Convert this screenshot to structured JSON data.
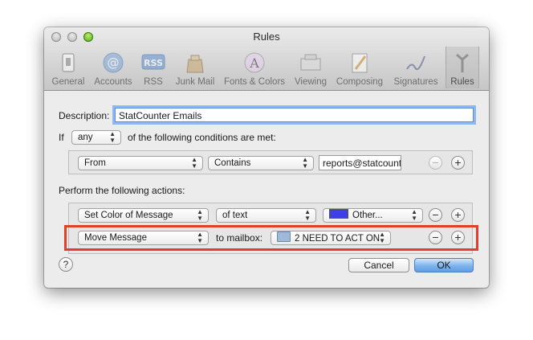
{
  "window": {
    "title": "Rules"
  },
  "toolbar": {
    "items": [
      {
        "label": "General"
      },
      {
        "label": "Accounts"
      },
      {
        "label": "RSS"
      },
      {
        "label": "Junk Mail"
      },
      {
        "label": "Fonts & Colors"
      },
      {
        "label": "Viewing"
      },
      {
        "label": "Composing"
      },
      {
        "label": "Signatures"
      },
      {
        "label": "Rules"
      }
    ]
  },
  "rule": {
    "description_label": "Description:",
    "description_value": "StatCounter Emails",
    "if_label": "If",
    "match_value": "any",
    "conditions_text": "of the following conditions are met:",
    "condition": {
      "field": "From",
      "operator": "Contains",
      "value": "reports@statcount"
    },
    "actions_label": "Perform the following actions:",
    "action1": {
      "action": "Set Color of Message",
      "target": "of text",
      "color_label": "Other..."
    },
    "action2": {
      "action": "Move Message",
      "to_label": "to mailbox:",
      "mailbox": "2 NEED TO ACT ON"
    }
  },
  "buttons": {
    "help": "?",
    "cancel": "Cancel",
    "ok": "OK",
    "minus": "−",
    "plus": "+"
  },
  "colors": {
    "highlight": "#e0402a",
    "swatch": "#3f3fe6",
    "accent": "#5f9ee4"
  }
}
